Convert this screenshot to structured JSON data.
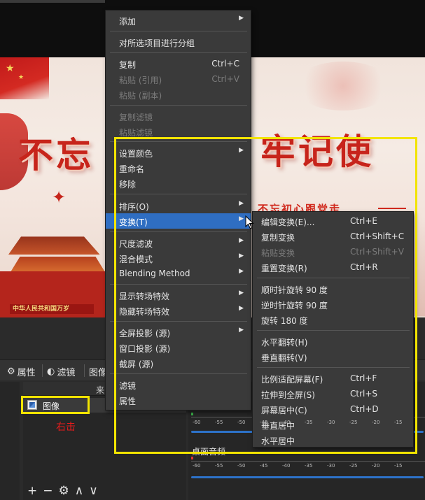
{
  "preview": {
    "calligraphy_left": "不忘",
    "calligraphy_right": "牢记使",
    "tagline": "不忘初心跟党走",
    "gate_banner": "中华人民共和国万岁"
  },
  "toolbar": {
    "properties_label": "属性",
    "filters_label": "滤镜",
    "image_label": "图像"
  },
  "sources": {
    "header_text": "来",
    "item_label": "图像",
    "annotation": "右击"
  },
  "mixer": {
    "channel_label": "桌面音频",
    "ticks": [
      "-60",
      "-55",
      "-50",
      "-45",
      "-40",
      "-35",
      "-30",
      "-25",
      "-20",
      "-15"
    ]
  },
  "main_menu": {
    "items": [
      {
        "label": "添加",
        "submenu": true
      },
      {
        "label": "对所选项目进行分组"
      },
      {
        "label": "复制",
        "shortcut": "Ctrl+C"
      },
      {
        "label": "粘贴 (引用)",
        "shortcut": "Ctrl+V",
        "disabled": true
      },
      {
        "label": "粘贴 (副本)",
        "disabled": true
      },
      {
        "label": "复制滤镜",
        "disabled": true
      },
      {
        "label": "粘贴滤镜",
        "disabled": true
      },
      {
        "label": "设置颜色",
        "submenu": true
      },
      {
        "label": "重命名"
      },
      {
        "label": "移除"
      },
      {
        "label": "排序(O)",
        "submenu": true
      },
      {
        "label": "变换(T)",
        "submenu": true,
        "selected": true
      },
      {
        "label": "尺度滤波",
        "submenu": true
      },
      {
        "label": "混合模式",
        "submenu": true
      },
      {
        "label": "Blending Method",
        "submenu": true
      },
      {
        "label": "显示转场特效",
        "submenu": true
      },
      {
        "label": "隐藏转场特效",
        "submenu": true
      },
      {
        "label": "全屏投影 (源)",
        "submenu": true
      },
      {
        "label": "窗口投影 (源)"
      },
      {
        "label": "截屏 (源)"
      },
      {
        "label": "滤镜"
      },
      {
        "label": "属性"
      }
    ]
  },
  "transform_menu": {
    "items": [
      {
        "label": "编辑变换(E)...",
        "shortcut": "Ctrl+E"
      },
      {
        "label": "复制变换",
        "shortcut": "Ctrl+Shift+C"
      },
      {
        "label": "粘贴变换",
        "shortcut": "Ctrl+Shift+V",
        "disabled": true
      },
      {
        "label": "重置变换(R)",
        "shortcut": "Ctrl+R"
      },
      {
        "label": "顺时针旋转 90 度"
      },
      {
        "label": "逆时针旋转 90 度"
      },
      {
        "label": "旋转 180 度"
      },
      {
        "label": "水平翻转(H)"
      },
      {
        "label": "垂直翻转(V)"
      },
      {
        "label": "比例适配屏幕(F)",
        "shortcut": "Ctrl+F"
      },
      {
        "label": "拉伸到全屏(S)",
        "shortcut": "Ctrl+S"
      },
      {
        "label": "屏幕居中(C)",
        "shortcut": "Ctrl+D"
      },
      {
        "label": "垂直居中"
      },
      {
        "label": "水平居中"
      }
    ]
  },
  "colors": {
    "menu_bg": "#3a3a3a",
    "selected_bg": "#2f6ec2",
    "highlight_box": "#f2e400",
    "annotation_red": "#e51c1c"
  }
}
